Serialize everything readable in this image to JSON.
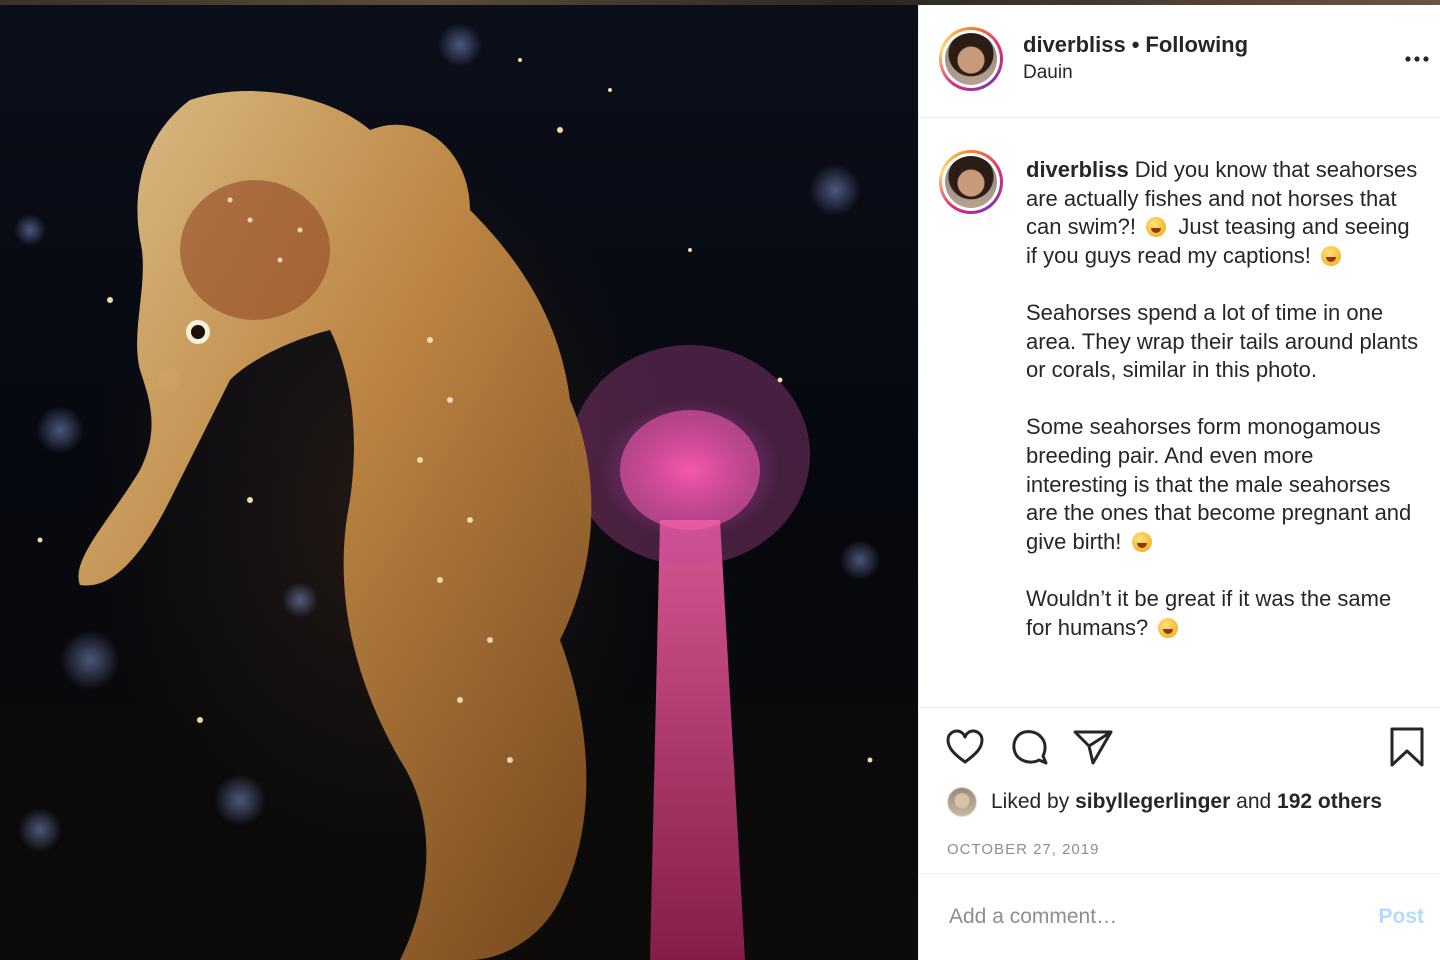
{
  "post": {
    "author": "diverbliss",
    "follow_status": "Following",
    "separator": "•",
    "location": "Dauin",
    "more_label": "•••"
  },
  "photo": {
    "subject_icon": "seahorse-photo"
  },
  "caption": {
    "username": "diverbliss",
    "paragraph_1": "Did you know that seahorses are actually fishes and not horses that can swim?!",
    "paragraph_1b": "Just teasing and seeing if you guys read my captions!",
    "paragraph_2": "Seahorses spend a lot of time in one area. They wrap their tails around plants or corals, similar in this photo.",
    "paragraph_3": "Some seahorses form monogamous breeding pair. And even more interesting is that the male seahorses are the ones that become pregnant and give birth!",
    "paragraph_4": "Wouldn’t it be great if it was the same for humans?"
  },
  "actions": {
    "like_icon": "heart-icon",
    "comment_icon": "comment-icon",
    "share_icon": "share-icon",
    "save_icon": "bookmark-icon"
  },
  "likes": {
    "prefix": "Liked by",
    "user": "sibyllegerlinger",
    "connector": "and",
    "others": "192 others"
  },
  "date": "OCTOBER 27, 2019",
  "comment": {
    "placeholder": "Add a comment…",
    "post_label": "Post"
  },
  "colors": {
    "text": "#262626",
    "muted": "#8e8e8e",
    "divider": "#efefef",
    "post_button_disabled": "#b3dbff"
  }
}
